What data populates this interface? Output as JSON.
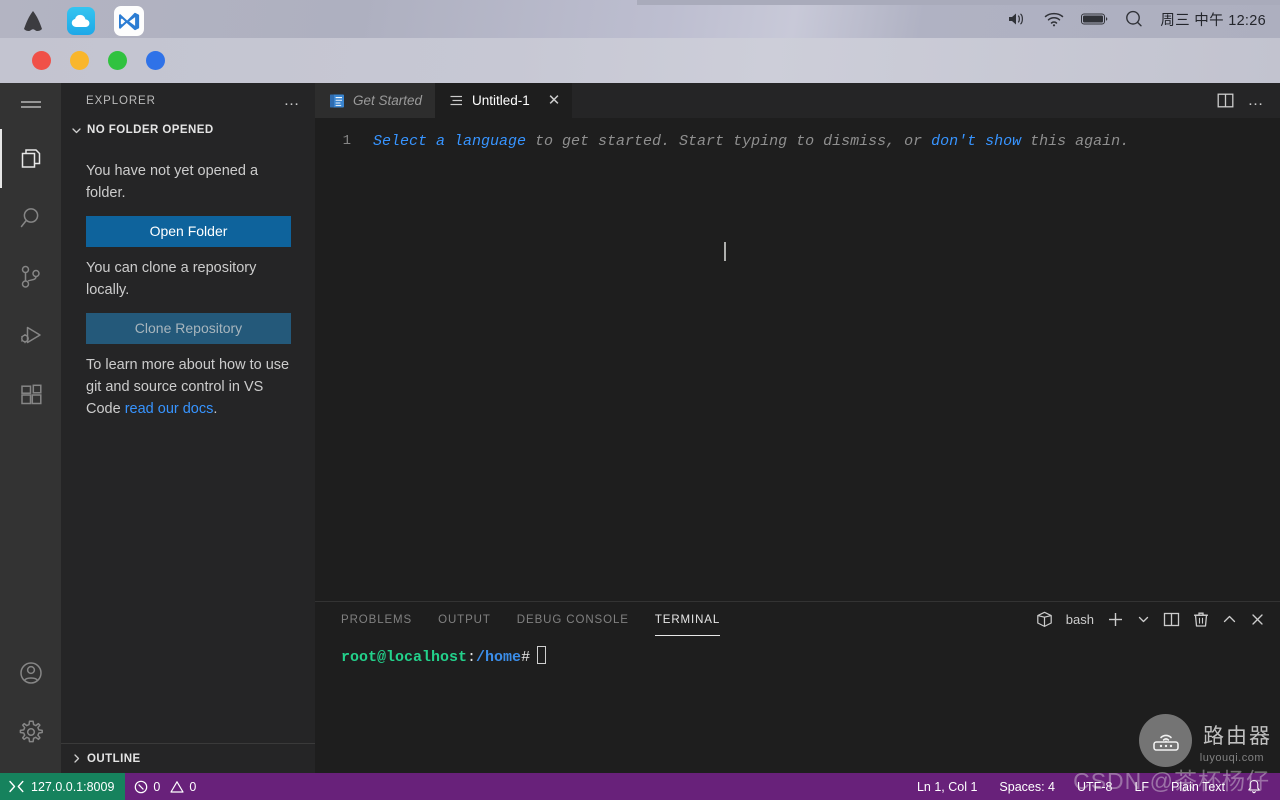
{
  "os_menubar": {
    "dock_items": [
      {
        "name": "arch-logo",
        "label": "Arch"
      },
      {
        "name": "cloud-app",
        "label": "Cloud"
      },
      {
        "name": "vscode-app",
        "label": "Visual Studio Code"
      }
    ],
    "tray_icons": [
      "volume-icon",
      "wifi-icon",
      "battery-icon",
      "spotlight-search-icon"
    ],
    "datetime": "周三 中午 12:26"
  },
  "window": {
    "traffic_lights": [
      "close",
      "minimize",
      "zoom",
      "extra"
    ]
  },
  "activity_bar": {
    "items": [
      {
        "name": "menu-icon",
        "label": "Menu",
        "active": false
      },
      {
        "name": "explorer-icon",
        "label": "Explorer",
        "active": true
      },
      {
        "name": "search-icon",
        "label": "Search",
        "active": false
      },
      {
        "name": "source-control-icon",
        "label": "Source Control",
        "active": false
      },
      {
        "name": "run-debug-icon",
        "label": "Run and Debug",
        "active": false
      },
      {
        "name": "extensions-icon",
        "label": "Extensions",
        "active": false
      }
    ],
    "bottom_items": [
      {
        "name": "account-icon",
        "label": "Accounts"
      },
      {
        "name": "settings-gear-icon",
        "label": "Manage"
      }
    ]
  },
  "sidebar": {
    "title": "EXPLORER",
    "more_actions": "…",
    "section_title": "NO FOLDER OPENED",
    "no_folder_text": "You have not yet opened a folder.",
    "open_folder_label": "Open Folder",
    "clone_text": "You can clone a repository locally.",
    "clone_repo_label": "Clone Repository",
    "docs_text_before": "To learn more about how to use git and source control in VS Code ",
    "docs_link": "read our docs",
    "docs_text_after": ".",
    "outline_label": "OUTLINE"
  },
  "editor": {
    "tabs": [
      {
        "label": "Get Started",
        "icon": "get-started-icon",
        "active": false,
        "closable": false
      },
      {
        "label": "Untitled-1",
        "icon": "file-text-icon",
        "active": true,
        "closable": true,
        "close_glyph": "✕"
      }
    ],
    "actions": [
      "split-editor-icon",
      "more-actions-icon"
    ],
    "line_number": "1",
    "placeholder": {
      "link1": "Select a language",
      "mid": " to get started. Start typing to dismiss, or ",
      "link2": "don't show",
      "tail": " this again."
    }
  },
  "panel": {
    "tabs": [
      {
        "label": "PROBLEMS",
        "active": false
      },
      {
        "label": "OUTPUT",
        "active": false
      },
      {
        "label": "DEBUG CONSOLE",
        "active": false
      },
      {
        "label": "TERMINAL",
        "active": true
      }
    ],
    "shell_name": "bash",
    "actions": [
      "terminal-cube-icon",
      "new-terminal-icon",
      "terminal-dropdown-icon",
      "split-terminal-icon",
      "kill-terminal-icon",
      "maximize-panel-icon",
      "close-panel-icon"
    ],
    "terminal": {
      "user_host": "root@localhost",
      "colon": ":",
      "path": "/home",
      "prompt_char": "#"
    }
  },
  "status_bar": {
    "remote": "127.0.0.1:8009",
    "errors": "0",
    "warnings": "0",
    "cursor_position": "Ln 1, Col 1",
    "indentation": "Spaces: 4",
    "encoding": "UTF-8",
    "eol": "LF",
    "language_mode": "Plain Text",
    "bell_icon": "notifications-bell-icon"
  },
  "watermark": {
    "chinese": "路由器",
    "url": "luyouqi.com",
    "csdn": "CSDN @茶杯杨仔"
  },
  "colors": {
    "status_bar_bg": "#68217a",
    "remote_bg": "#16825d",
    "accent_blue": "#0e639c",
    "link_blue": "#3794ff",
    "terminal_green": "#23d18b",
    "terminal_blue": "#3b8eea",
    "editor_bg": "#1e1e1e",
    "sidebar_bg": "#252526",
    "activitybar_bg": "#333333"
  }
}
